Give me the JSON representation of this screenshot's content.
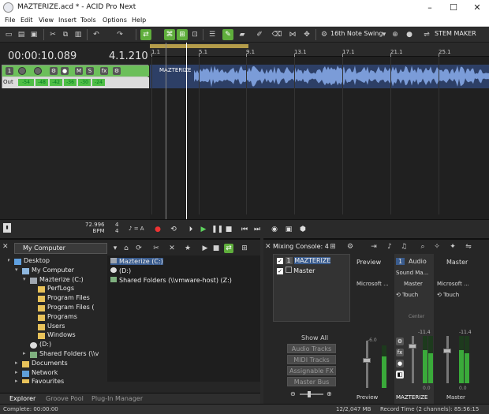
{
  "window": {
    "title": "MAZTERIZE.acd * - ACID Pro Next",
    "minimize": "–",
    "maximize": "☐",
    "close": "✕"
  },
  "menu": [
    "File",
    "Edit",
    "View",
    "Insert",
    "Tools",
    "Options",
    "Help"
  ],
  "toolbar": {
    "grid_label": "16th Note Swing",
    "stem_maker_label": "STEM MAKER"
  },
  "track_header": {
    "timecode": "00:00:10.089",
    "beatcode": "4.1.210",
    "out_label": "Out",
    "meter_labels": [
      "-54",
      "-48",
      "-42",
      "-36",
      "-30",
      "-24"
    ]
  },
  "timeline": {
    "ruler_ticks": [
      "1.1",
      "5.1",
      "9.1",
      "13.1",
      "17.1",
      "21.1",
      "25.1"
    ],
    "clip_label": "MAZTERIZE"
  },
  "transport": {
    "tempo_value": "72.996",
    "tempo_unit": "BPM",
    "time_sig_top": "4",
    "time_sig_bottom": "4",
    "swing_label": "♪ = A"
  },
  "explorer": {
    "path": "My Computer",
    "tree": [
      {
        "label": "Desktop",
        "indent": 0,
        "icon": "desktop"
      },
      {
        "label": "My Computer",
        "indent": 1,
        "icon": "computer"
      },
      {
        "label": "Mazterize (C:)",
        "indent": 2,
        "icon": "drive"
      },
      {
        "label": "PerfLogs",
        "indent": 3,
        "icon": "folder"
      },
      {
        "label": "Program Files",
        "indent": 3,
        "icon": "folder"
      },
      {
        "label": "Program Files (",
        "indent": 3,
        "icon": "folder"
      },
      {
        "label": "Programs",
        "indent": 3,
        "icon": "folder"
      },
      {
        "label": "Users",
        "indent": 3,
        "icon": "folder"
      },
      {
        "label": "Windows",
        "indent": 3,
        "icon": "folder"
      },
      {
        "label": "(D:)",
        "indent": 2,
        "icon": "disc"
      },
      {
        "label": "Shared Folders (\\\\v",
        "indent": 2,
        "icon": "netdrive"
      },
      {
        "label": "Documents",
        "indent": 1,
        "icon": "folder"
      },
      {
        "label": "Network",
        "indent": 1,
        "icon": "network"
      },
      {
        "label": "Favourites",
        "indent": 1,
        "icon": "folder"
      }
    ],
    "files": [
      {
        "label": "Mazterize (C:)",
        "selected": true
      },
      {
        "label": "(D:)",
        "selected": false
      },
      {
        "label": "Shared Folders (\\\\vmware-host) (Z:)",
        "selected": false
      }
    ],
    "tabs": [
      "Explorer",
      "Groove Pool",
      "Plug-In Manager"
    ]
  },
  "mixer": {
    "title": "Mixing Console: 4",
    "list": [
      {
        "num": "1",
        "label": "MAZTERIZE",
        "selected": true
      },
      {
        "num": "",
        "label": "Master",
        "selected": false
      }
    ],
    "show_all": "Show All",
    "filters": [
      "Audio Tracks",
      "MIDI Tracks",
      "Assignable FX",
      "Master Bus"
    ],
    "channels": [
      {
        "name": "Preview",
        "device": "Microsoft ...",
        "bottom": "Preview",
        "level": "-6.0"
      },
      {
        "name": "Audio",
        "num": "1",
        "device": "Sound Ma...",
        "bus": "Master",
        "mode": "Touch",
        "bottom": "MAZTERIZE",
        "level": "-11.4",
        "db": "0.0"
      },
      {
        "name": "Master",
        "device": "Microsoft ...",
        "mode": "Touch",
        "bottom": "Master",
        "level": "-11.4",
        "db": "0.0"
      }
    ],
    "center_label": "Center"
  },
  "status": {
    "left": "Complete: 00:00:00",
    "memory": "12/2,047 MB",
    "record": "Record Time (2 channels): 85:56:15"
  },
  "colors": {
    "accent_green": "#5fae3c",
    "waveform": "#7b9cd8",
    "selection": "#3a5c8e",
    "loop_region": "#b49c4a"
  }
}
